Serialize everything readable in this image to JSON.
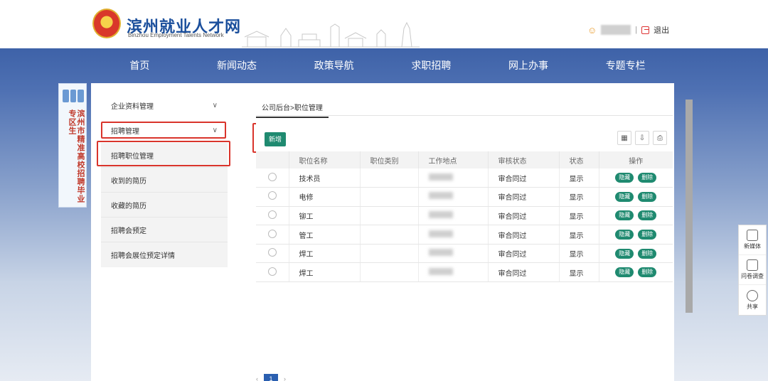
{
  "header": {
    "site_title": "滨州就业人才网",
    "site_subtitle": "Binzhou Employment Talents Network",
    "separator": "|",
    "logout": "退出"
  },
  "nav": [
    "首页",
    "新闻动态",
    "政策导航",
    "求职招聘",
    "网上办事",
    "专题专栏"
  ],
  "side_banner": {
    "text": "滨州市精准高校招聘毕业专区生"
  },
  "menu": {
    "enterprise": "企业资料管理",
    "recruit": "招聘管理",
    "sub_items": [
      "招聘职位管理",
      "收到的简历",
      "收藏的简历",
      "招聘会预定",
      "招聘会展位预定详情"
    ]
  },
  "content": {
    "breadcrumb": "公司后台>职位管理",
    "add_button": "新增",
    "columns": [
      "职位名称",
      "职位类别",
      "工作地点",
      "审核状态",
      "状态",
      "操作"
    ],
    "rows": [
      {
        "name": "技术员",
        "audit": "审合同过",
        "status": "显示"
      },
      {
        "name": "电修",
        "audit": "审合同过",
        "status": "显示"
      },
      {
        "name": "铆工",
        "audit": "审合同过",
        "status": "显示"
      },
      {
        "name": "管工",
        "audit": "审合同过",
        "status": "显示"
      },
      {
        "name": "焊工",
        "audit": "审合同过",
        "status": "显示"
      },
      {
        "name": "焊工",
        "audit": "审合同过",
        "status": "显示"
      }
    ],
    "op_hide": "隐藏",
    "op_delete": "删除",
    "pager_current": "1"
  },
  "side_tools": [
    "新媒体",
    "问卷调查",
    "共享"
  ],
  "colors": {
    "nav_blue": "#3e62a8",
    "accent_green": "#1f8a70",
    "highlight_red": "#d9342b"
  }
}
